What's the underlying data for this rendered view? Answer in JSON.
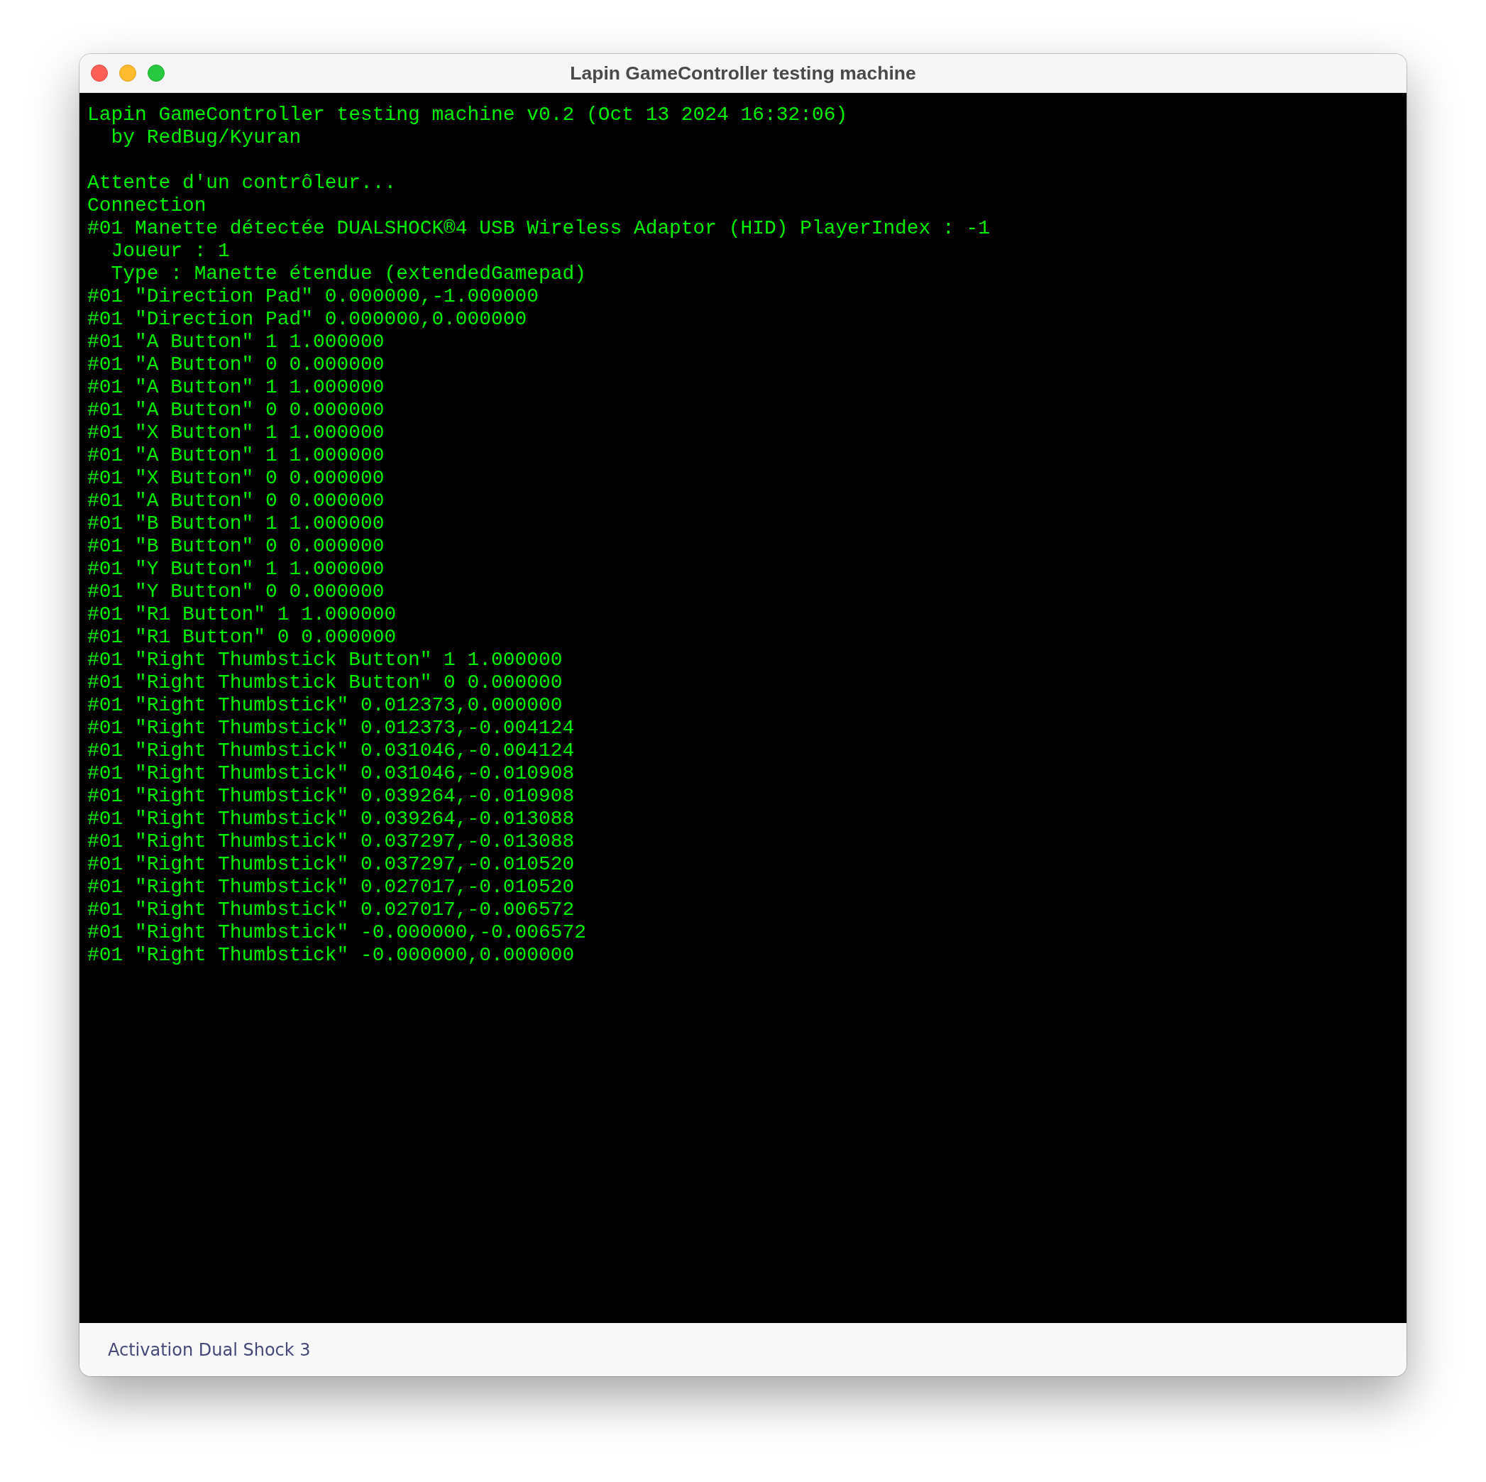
{
  "window": {
    "title": "Lapin GameController testing machine"
  },
  "console": {
    "blocks": [
      [
        "Lapin GameController testing machine v0.2 (Oct 13 2024 16:32:06)",
        "  by RedBug/Kyuran"
      ],
      [
        "Attente d'un contrôleur...",
        "Connection",
        "#01 Manette détectée DUALSHOCK®4 USB Wireless Adaptor (HID) PlayerIndex : -1",
        "  Joueur : 1",
        "  Type : Manette étendue (extendedGamepad)",
        "#01 \"Direction Pad\" 0.000000,-1.000000",
        "#01 \"Direction Pad\" 0.000000,0.000000",
        "#01 \"A Button\" 1 1.000000",
        "#01 \"A Button\" 0 0.000000",
        "#01 \"A Button\" 1 1.000000",
        "#01 \"A Button\" 0 0.000000",
        "#01 \"X Button\" 1 1.000000",
        "#01 \"A Button\" 1 1.000000",
        "#01 \"X Button\" 0 0.000000",
        "#01 \"A Button\" 0 0.000000",
        "#01 \"B Button\" 1 1.000000",
        "#01 \"B Button\" 0 0.000000",
        "#01 \"Y Button\" 1 1.000000",
        "#01 \"Y Button\" 0 0.000000",
        "#01 \"R1 Button\" 1 1.000000",
        "#01 \"R1 Button\" 0 0.000000",
        "#01 \"Right Thumbstick Button\" 1 1.000000",
        "#01 \"Right Thumbstick Button\" 0 0.000000",
        "#01 \"Right Thumbstick\" 0.012373,0.000000",
        "#01 \"Right Thumbstick\" 0.012373,-0.004124",
        "#01 \"Right Thumbstick\" 0.031046,-0.004124",
        "#01 \"Right Thumbstick\" 0.031046,-0.010908",
        "#01 \"Right Thumbstick\" 0.039264,-0.010908",
        "#01 \"Right Thumbstick\" 0.039264,-0.013088",
        "#01 \"Right Thumbstick\" 0.037297,-0.013088",
        "#01 \"Right Thumbstick\" 0.037297,-0.010520",
        "#01 \"Right Thumbstick\" 0.027017,-0.010520",
        "#01 \"Right Thumbstick\" 0.027017,-0.006572",
        "#01 \"Right Thumbstick\" -0.000000,-0.006572",
        "#01 \"Right Thumbstick\" -0.000000,0.000000"
      ]
    ]
  },
  "footer": {
    "button": "Activation Dual Shock 3"
  }
}
